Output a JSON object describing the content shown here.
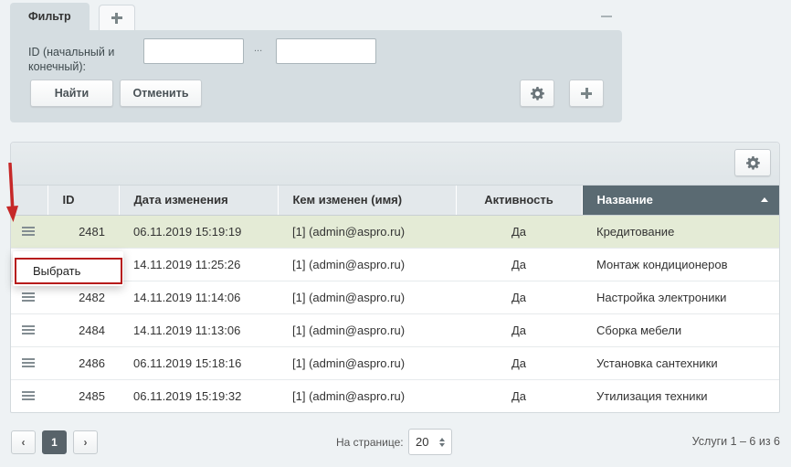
{
  "filter": {
    "tab_label": "Фильтр",
    "id_label": "ID (начальный и конечный):",
    "id_from_value": "",
    "id_to_value": "",
    "range_separator": "...",
    "find_button": "Найти",
    "cancel_button": "Отменить"
  },
  "grid": {
    "columns": [
      "ID",
      "Дата изменения",
      "Кем изменен (имя)",
      "Активность",
      "Название"
    ],
    "sorted_column": "Название",
    "rows": [
      {
        "id": "2481",
        "date": "06.11.2019 15:19:19",
        "by": "[1] (admin@aspro.ru)",
        "active": "Да",
        "name": "Кредитование"
      },
      {
        "id": "",
        "date": "14.11.2019 11:25:26",
        "by": "[1] (admin@aspro.ru)",
        "active": "Да",
        "name": "Монтаж кондиционеров"
      },
      {
        "id": "2482",
        "date": "14.11.2019 11:14:06",
        "by": "[1] (admin@aspro.ru)",
        "active": "Да",
        "name": "Настройка электроники"
      },
      {
        "id": "2484",
        "date": "14.11.2019 11:13:06",
        "by": "[1] (admin@aspro.ru)",
        "active": "Да",
        "name": "Сборка мебели"
      },
      {
        "id": "2486",
        "date": "06.11.2019 15:18:16",
        "by": "[1] (admin@aspro.ru)",
        "active": "Да",
        "name": "Установка сантехники"
      },
      {
        "id": "2485",
        "date": "06.11.2019 15:19:32",
        "by": "[1] (admin@aspro.ru)",
        "active": "Да",
        "name": "Утилизация техники"
      }
    ]
  },
  "context_menu": {
    "select_item": "Выбрать"
  },
  "pager": {
    "current_page": "1",
    "per_page_label": "На странице:",
    "per_page_value": "20",
    "total_text": "Услуги 1 – 6 из 6"
  },
  "colors": {
    "highlight": "#b71c1c",
    "selected_row": "#e4ebd6",
    "sorted_header": "#5a6a72"
  }
}
